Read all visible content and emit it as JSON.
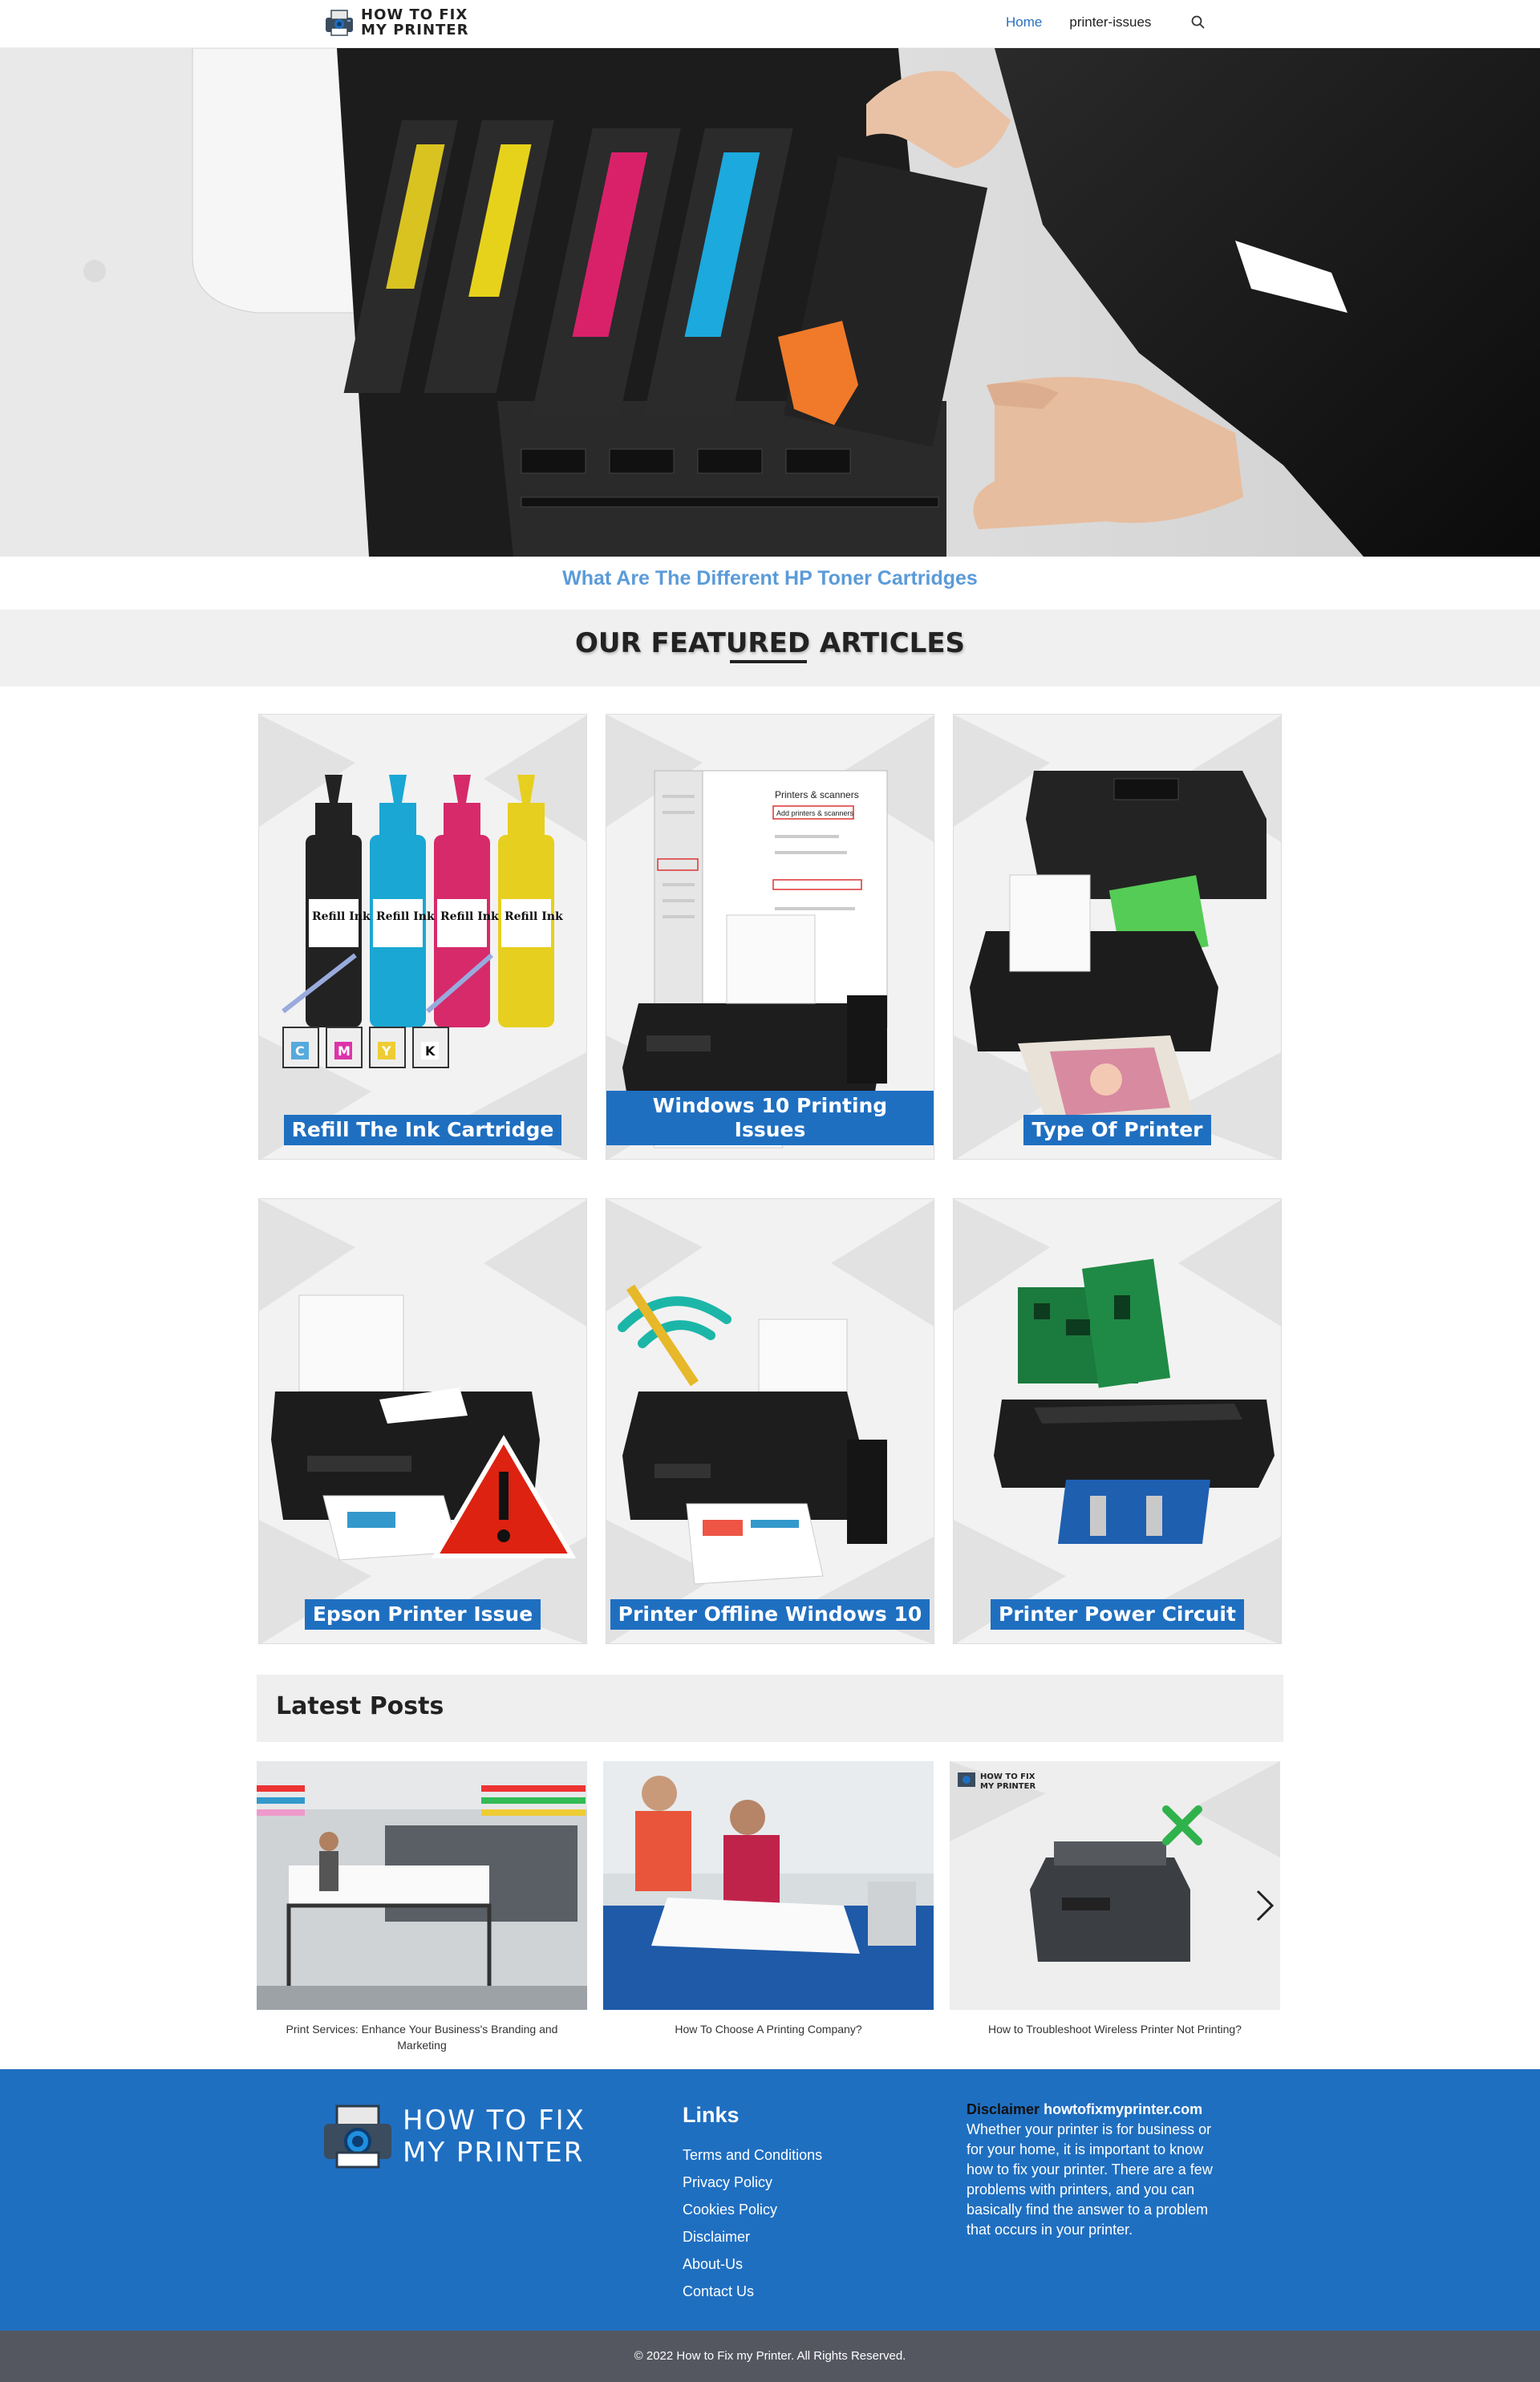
{
  "header": {
    "logo_line1": "HOW TO FIX",
    "logo_line2": "MY PRINTER",
    "nav": [
      "Home",
      "printer-issues"
    ]
  },
  "hero": {
    "caption": "What Are The Different HP Toner Cartridges"
  },
  "featured": {
    "title": "OUR FEATURED ARTICLES",
    "cards": [
      {
        "label": "Refill The Ink Cartridge"
      },
      {
        "label": "Windows 10 Printing Issues"
      },
      {
        "label": "Type Of Printer"
      },
      {
        "label": "Epson Printer Issue"
      },
      {
        "label": "Printer Offline Windows 10"
      },
      {
        "label": "Printer Power Circuit"
      }
    ],
    "refill_bottle_label": "Refill Ink",
    "cartridge_letters": [
      "C",
      "M",
      "Y",
      "K"
    ],
    "win_panel_title": "Printers & scanners",
    "win_panel_add": "Add printers & scanners"
  },
  "latest": {
    "title": "Latest Posts",
    "posts": [
      {
        "caption": "Print Services: Enhance Your Business's Branding and Marketing"
      },
      {
        "caption": "How To Choose A Printing Company?"
      },
      {
        "caption": "How to Troubleshoot Wireless Printer Not Printing?"
      }
    ],
    "post3_logo_line1": "HOW TO FIX",
    "post3_logo_line2": "MY PRINTER"
  },
  "footer": {
    "logo_line1": "HOW TO FIX",
    "logo_line2": "MY PRINTER",
    "links_title": "Links",
    "links": [
      "Terms and Conditions",
      "Privacy Policy",
      "Cookies Policy",
      "Disclaimer",
      "About-Us",
      "Contact Us"
    ],
    "disclaimer_label": "Disclaimer",
    "disclaimer_site": "howtofixmyprinter.com",
    "disclaimer_text": "Whether your printer is for business or for your home, it is important to know how to fix your printer. There are a few problems with printers, and you can basically find the answer to a problem that occurs in your printer.",
    "copyright": "© 2022 How to Fix my Printer. All Rights Reserved."
  },
  "colors": {
    "brand_blue": "#1f6fc1",
    "caption_blue": "#5b9bd8",
    "copyright_bg": "#555760"
  },
  "icons": [
    "printer-logo-icon",
    "search-icon",
    "chevron-right-icon"
  ]
}
